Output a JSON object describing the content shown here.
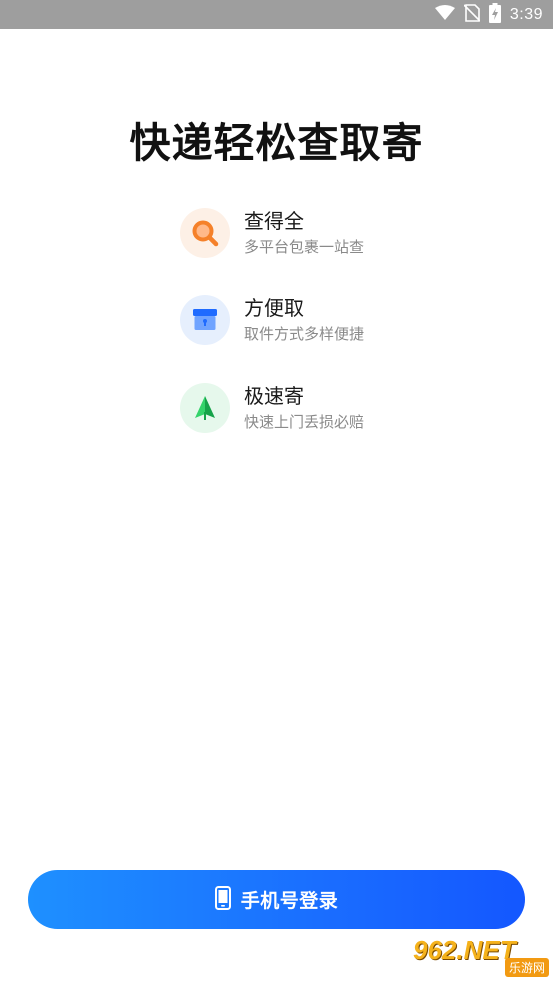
{
  "status_bar": {
    "time": "3:39",
    "icons": [
      "wifi-icon",
      "no-sim-icon",
      "battery-charging-icon"
    ]
  },
  "headline": "快递轻松查取寄",
  "features": [
    {
      "title": "查得全",
      "subtitle": "多平台包裹一站查",
      "icon": "search-icon",
      "accent": "#F5812A",
      "bg": "#FDF0E6"
    },
    {
      "title": "方便取",
      "subtitle": "取件方式多样便捷",
      "icon": "parcel-locker-icon",
      "accent": "#2F7BFF",
      "bg": "#E6EFFD"
    },
    {
      "title": "极速寄",
      "subtitle": "快速上门丢损必赔",
      "icon": "paper-plane-icon",
      "accent": "#22C55E",
      "bg": "#E6F8EC"
    }
  ],
  "login": {
    "label": "手机号登录",
    "icon": "phone-icon",
    "gradient_start": "#1E90FF",
    "gradient_end": "#1457FF"
  },
  "watermark": {
    "logo_text": "962.NET",
    "sub_text": "乐游网"
  }
}
